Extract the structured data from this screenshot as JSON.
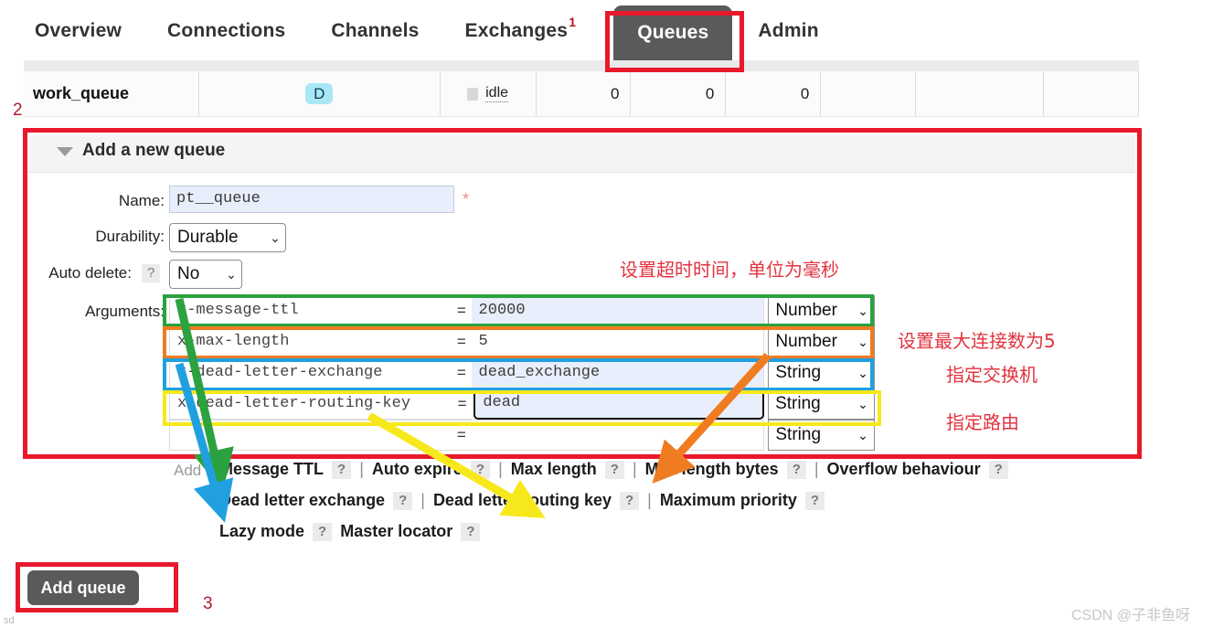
{
  "nav": {
    "items": [
      {
        "label": "Overview",
        "active": false
      },
      {
        "label": "Connections",
        "active": false
      },
      {
        "label": "Channels",
        "active": false
      },
      {
        "label": "Exchanges",
        "active": false
      },
      {
        "label": "Queues",
        "active": true
      },
      {
        "label": "Admin",
        "active": false
      }
    ]
  },
  "queue_table": {
    "row": {
      "name": "work_queue",
      "features": "D",
      "state_label": "idle",
      "ready": "0",
      "unacked": "0",
      "total": "0"
    }
  },
  "panel": {
    "title": "Add a new queue",
    "labels": {
      "name": "Name:",
      "durability": "Durability:",
      "auto_delete": "Auto delete:",
      "arguments": "Arguments:",
      "add_faded": "Add"
    },
    "name_value": "pt__queue",
    "name_required_mark": "*",
    "help_mark": "?",
    "durability_value": "Durable",
    "auto_delete_value": "No",
    "chevron": "⌄",
    "equals": "=",
    "arguments": [
      {
        "key": "x-message-ttl",
        "value": "20000",
        "type": "Number",
        "value_filled": true,
        "focused": false
      },
      {
        "key": "x-max-length",
        "value": "5",
        "type": "Number",
        "value_filled": false,
        "focused": false
      },
      {
        "key": "x-dead-letter-exchange",
        "value": "dead_exchange",
        "type": "String",
        "value_filled": true,
        "focused": false
      },
      {
        "key": "x-dead-letter-routing-key",
        "value": "dead",
        "type": "String",
        "value_filled": true,
        "focused": true
      },
      {
        "key": "",
        "value": "",
        "type": "String",
        "value_filled": false,
        "focused": false
      }
    ]
  },
  "help_links": {
    "row1": [
      "Message TTL",
      "Auto expire",
      "Max length",
      "Max length bytes",
      "Overflow behaviour"
    ],
    "row2": [
      "Dead letter exchange",
      "Dead letter routing key",
      "Maximum priority"
    ],
    "row3": [
      "Lazy mode",
      "Master locator"
    ],
    "separator": "|",
    "mark": "?"
  },
  "footer": {
    "add_queue_button": "Add queue",
    "step3": "3",
    "small_text": "sd",
    "watermark": "CSDN @子非鱼呀"
  },
  "annotations": {
    "step1": "1",
    "step2": "2",
    "cn_ttl": "设置超时时间，单位为毫秒",
    "cn_max_length": "设置最大连接数为5",
    "cn_exchange": "指定交换机",
    "cn_routing": "指定路由",
    "colors": {
      "red": "#e8192c",
      "green": "#2ba23f",
      "orange": "#f07c22",
      "blue": "#21a0e0",
      "yellow": "#f7e81b",
      "cn_text": "#e2333f"
    }
  }
}
